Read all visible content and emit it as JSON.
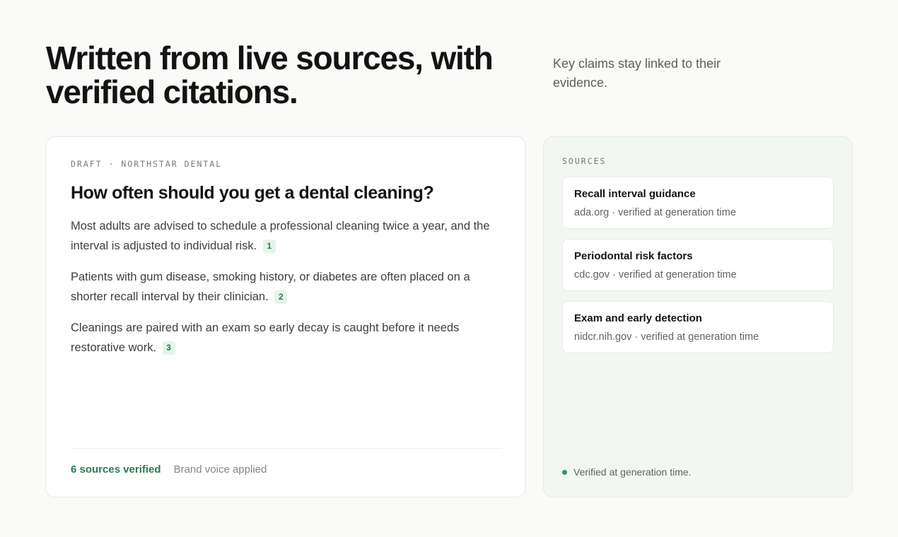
{
  "header": {
    "headline": "Written from live sources, with verified citations.",
    "subtitle": "Key claims stay linked to their evidence."
  },
  "draft": {
    "eyebrow": "DRAFT · NORTHSTAR DENTAL",
    "title": "How often should you get a dental cleaning?",
    "paragraphs": [
      {
        "text": "Most adults are advised to schedule a professional cleaning twice a year, and the interval is adjusted to individual risk.",
        "cite": "1"
      },
      {
        "text": "Patients with gum disease, smoking history, or diabetes are often placed on a shorter recall interval by their clinician.",
        "cite": "2"
      },
      {
        "text": "Cleanings are paired with an exam so early decay is caught before it needs restorative work.",
        "cite": "3"
      }
    ],
    "footer": {
      "verified": "6 sources verified",
      "brand_voice": "Brand voice applied"
    }
  },
  "sources": {
    "label": "SOURCES",
    "items": [
      {
        "title": "Recall interval guidance",
        "meta": "ada.org · verified at generation time"
      },
      {
        "title": "Periodontal risk factors",
        "meta": "cdc.gov · verified at generation time"
      },
      {
        "title": "Exam and early detection",
        "meta": "nidcr.nih.gov · verified at generation time"
      }
    ],
    "footer": "Verified at generation time."
  },
  "colors": {
    "accent": "#2c7a55",
    "citation_bg": "#e5f4ea",
    "status_dot": "#2a9a63"
  }
}
